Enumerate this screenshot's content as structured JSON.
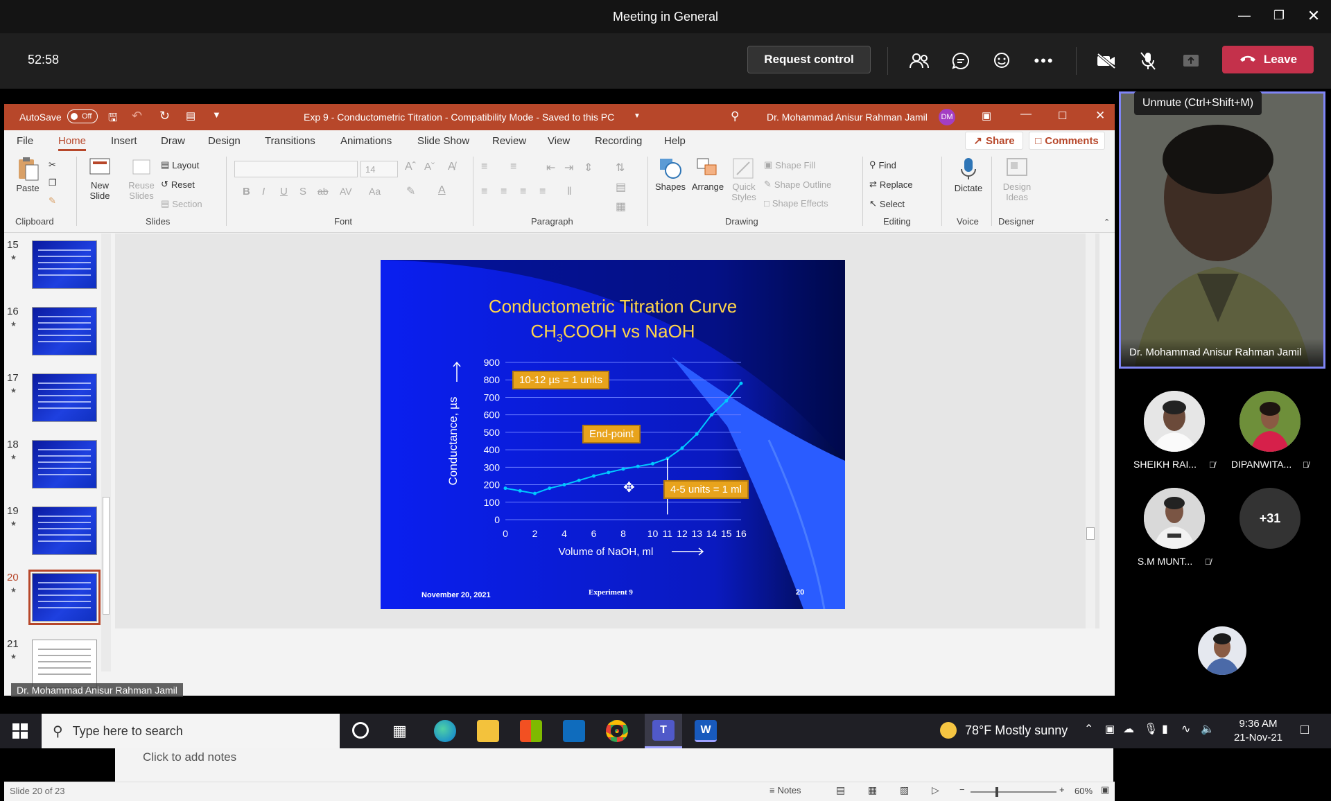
{
  "meeting": {
    "title": "Meeting in General",
    "timer": "52:58",
    "request_control_label": "Request control",
    "leave_label": "Leave",
    "unmute_tooltip": "Unmute (Ctrl+Shift+M)",
    "presenter_name": "Dr. Mohammad Anisur Rahman Jamil",
    "share_label": "Dr. Mohammad Anisur Rahman Jamil",
    "participants": [
      {
        "name": "SHEIKH RAI...",
        "muted": true
      },
      {
        "name": "DIPANWITA...",
        "muted": true
      },
      {
        "name": "S.M MUNT...",
        "muted": true
      }
    ],
    "more_count": "+31"
  },
  "ppt": {
    "autosave_label": "AutoSave",
    "autosave_state": "Off",
    "doc_title": "Exp 9 - Conductometric Titration  -  Compatibility Mode  -  Saved to this PC",
    "user_name": "Dr. Mohammad Anisur Rahman Jamil",
    "user_initials": "DM",
    "tabs": [
      "File",
      "Home",
      "Insert",
      "Draw",
      "Design",
      "Transitions",
      "Animations",
      "Slide Show",
      "Review",
      "View",
      "Recording",
      "Help"
    ],
    "share_button": "Share",
    "comments_button": "Comments",
    "ribbon": {
      "paste": "Paste",
      "new_slide": "New Slide",
      "reuse_slides": "Reuse Slides",
      "layout": "Layout",
      "reset": "Reset",
      "section": "Section",
      "font_size": "14",
      "shapes": "Shapes",
      "arrange": "Arrange",
      "quick_styles": "Quick Styles",
      "shape_fill": "Shape Fill",
      "shape_outline": "Shape Outline",
      "shape_effects": "Shape Effects",
      "find": "Find",
      "replace": "Replace",
      "select": "Select",
      "dictate": "Dictate",
      "design_ideas": "Design Ideas",
      "groups": {
        "clipboard": "Clipboard",
        "slides": "Slides",
        "font": "Font",
        "paragraph": "Paragraph",
        "drawing": "Drawing",
        "editing": "Editing",
        "voice": "Voice",
        "designer": "Designer"
      }
    },
    "thumbnails": [
      "15",
      "16",
      "17",
      "18",
      "19",
      "20",
      "21"
    ],
    "selected_thumb": "20",
    "notes_placeholder": "Click to add notes",
    "status": {
      "slide_info": "Slide 20 of 23",
      "notes": "Notes",
      "zoom": "60%"
    }
  },
  "slide": {
    "title_line1": "Conductometric Titration Curve",
    "title_line2_a": "CH",
    "title_line2_sub": "3",
    "title_line2_b": "COOH vs NaOH",
    "scale_label": "10-12 µs = 1 units",
    "endpoint_label": "End-point",
    "xscale_label": "4-5 units = 1 ml",
    "footer_date": "November 20, 2021",
    "footer_center": "Experiment 9",
    "footer_page": "20"
  },
  "chart_data": {
    "type": "line",
    "xlabel": "Volume of NaOH, ml",
    "ylabel": "Conductance, µs",
    "x": [
      0,
      1,
      2,
      3,
      4,
      5,
      6,
      7,
      8,
      9,
      10,
      11,
      12,
      13,
      14,
      15,
      16
    ],
    "y": [
      180,
      165,
      150,
      180,
      200,
      225,
      250,
      270,
      290,
      305,
      320,
      350,
      410,
      490,
      600,
      680,
      780
    ],
    "xticks": [
      0,
      2,
      4,
      6,
      8,
      10,
      11,
      12,
      13,
      14,
      15,
      16
    ],
    "yticks": [
      0,
      100,
      200,
      300,
      400,
      500,
      600,
      700,
      800,
      900
    ],
    "xlim": [
      0,
      16
    ],
    "ylim": [
      0,
      900
    ],
    "endpoint_x": 11,
    "grid": true,
    "line_color": "#00c8ff"
  },
  "taskbar": {
    "search_placeholder": "Type here to search",
    "weather": "78°F  Mostly sunny",
    "time": "9:36 AM",
    "date": "21-Nov-21"
  },
  "colors": {
    "ppt_accent": "#b7472a",
    "teams_leave": "#c4314b",
    "slide_bg": "#0a1ff0",
    "teams_highlight": "#7f85f5"
  }
}
